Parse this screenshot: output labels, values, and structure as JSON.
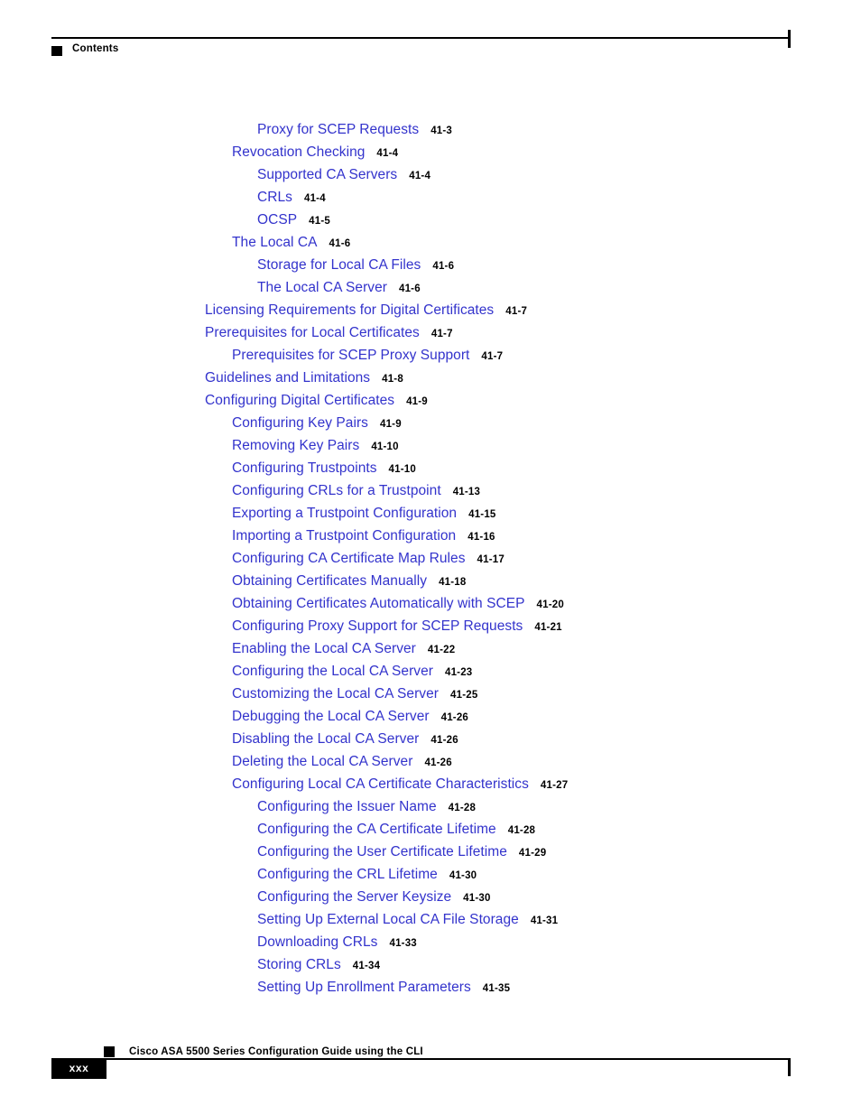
{
  "header": {
    "title": "Contents",
    "marker_icon": "black-square-icon"
  },
  "footer": {
    "book_title": "Cisco ASA 5500 Series Configuration Guide using the CLI",
    "page_number": "xxx",
    "marker_icon": "black-square-icon"
  },
  "colors": {
    "link": "#3333cc",
    "text": "#000000",
    "page_background": "#ffffff"
  },
  "toc": {
    "entries": [
      {
        "title": "Proxy for SCEP Requests",
        "page": "41-3",
        "level": 3
      },
      {
        "title": "Revocation Checking",
        "page": "41-4",
        "level": 2
      },
      {
        "title": "Supported CA Servers",
        "page": "41-4",
        "level": 3
      },
      {
        "title": "CRLs",
        "page": "41-4",
        "level": 3
      },
      {
        "title": "OCSP",
        "page": "41-5",
        "level": 3
      },
      {
        "title": "The Local CA",
        "page": "41-6",
        "level": 2
      },
      {
        "title": "Storage for Local CA Files",
        "page": "41-6",
        "level": 3
      },
      {
        "title": "The Local CA Server",
        "page": "41-6",
        "level": 3
      },
      {
        "title": "Licensing Requirements for Digital Certificates",
        "page": "41-7",
        "level": 1
      },
      {
        "title": "Prerequisites for Local Certificates",
        "page": "41-7",
        "level": 1
      },
      {
        "title": "Prerequisites for SCEP Proxy Support",
        "page": "41-7",
        "level": 2
      },
      {
        "title": "Guidelines and Limitations",
        "page": "41-8",
        "level": 1
      },
      {
        "title": "Configuring Digital Certificates",
        "page": "41-9",
        "level": 1
      },
      {
        "title": "Configuring Key Pairs",
        "page": "41-9",
        "level": 2
      },
      {
        "title": "Removing Key Pairs",
        "page": "41-10",
        "level": 2
      },
      {
        "title": "Configuring Trustpoints",
        "page": "41-10",
        "level": 2
      },
      {
        "title": "Configuring CRLs for a Trustpoint",
        "page": "41-13",
        "level": 2
      },
      {
        "title": "Exporting a Trustpoint Configuration",
        "page": "41-15",
        "level": 2
      },
      {
        "title": "Importing a Trustpoint Configuration",
        "page": "41-16",
        "level": 2
      },
      {
        "title": "Configuring CA Certificate Map Rules",
        "page": "41-17",
        "level": 2
      },
      {
        "title": "Obtaining Certificates Manually",
        "page": "41-18",
        "level": 2
      },
      {
        "title": "Obtaining Certificates Automatically with SCEP",
        "page": "41-20",
        "level": 2
      },
      {
        "title": "Configuring Proxy Support for SCEP Requests",
        "page": "41-21",
        "level": 2
      },
      {
        "title": "Enabling the Local CA Server",
        "page": "41-22",
        "level": 2
      },
      {
        "title": "Configuring the Local CA Server",
        "page": "41-23",
        "level": 2
      },
      {
        "title": "Customizing the Local CA Server",
        "page": "41-25",
        "level": 2
      },
      {
        "title": "Debugging the Local CA Server",
        "page": "41-26",
        "level": 2
      },
      {
        "title": "Disabling the Local CA Server",
        "page": "41-26",
        "level": 2
      },
      {
        "title": "Deleting the Local CA Server",
        "page": "41-26",
        "level": 2
      },
      {
        "title": "Configuring Local CA Certificate Characteristics",
        "page": "41-27",
        "level": 2
      },
      {
        "title": "Configuring the Issuer Name",
        "page": "41-28",
        "level": 3
      },
      {
        "title": "Configuring the CA Certificate Lifetime",
        "page": "41-28",
        "level": 3
      },
      {
        "title": "Configuring the User Certificate Lifetime",
        "page": "41-29",
        "level": 3
      },
      {
        "title": "Configuring the CRL Lifetime",
        "page": "41-30",
        "level": 3
      },
      {
        "title": "Configuring the Server Keysize",
        "page": "41-30",
        "level": 3
      },
      {
        "title": "Setting Up External Local CA File Storage",
        "page": "41-31",
        "level": 3
      },
      {
        "title": "Downloading CRLs",
        "page": "41-33",
        "level": 3
      },
      {
        "title": "Storing CRLs",
        "page": "41-34",
        "level": 3
      },
      {
        "title": "Setting Up Enrollment Parameters",
        "page": "41-35",
        "level": 3
      }
    ]
  }
}
